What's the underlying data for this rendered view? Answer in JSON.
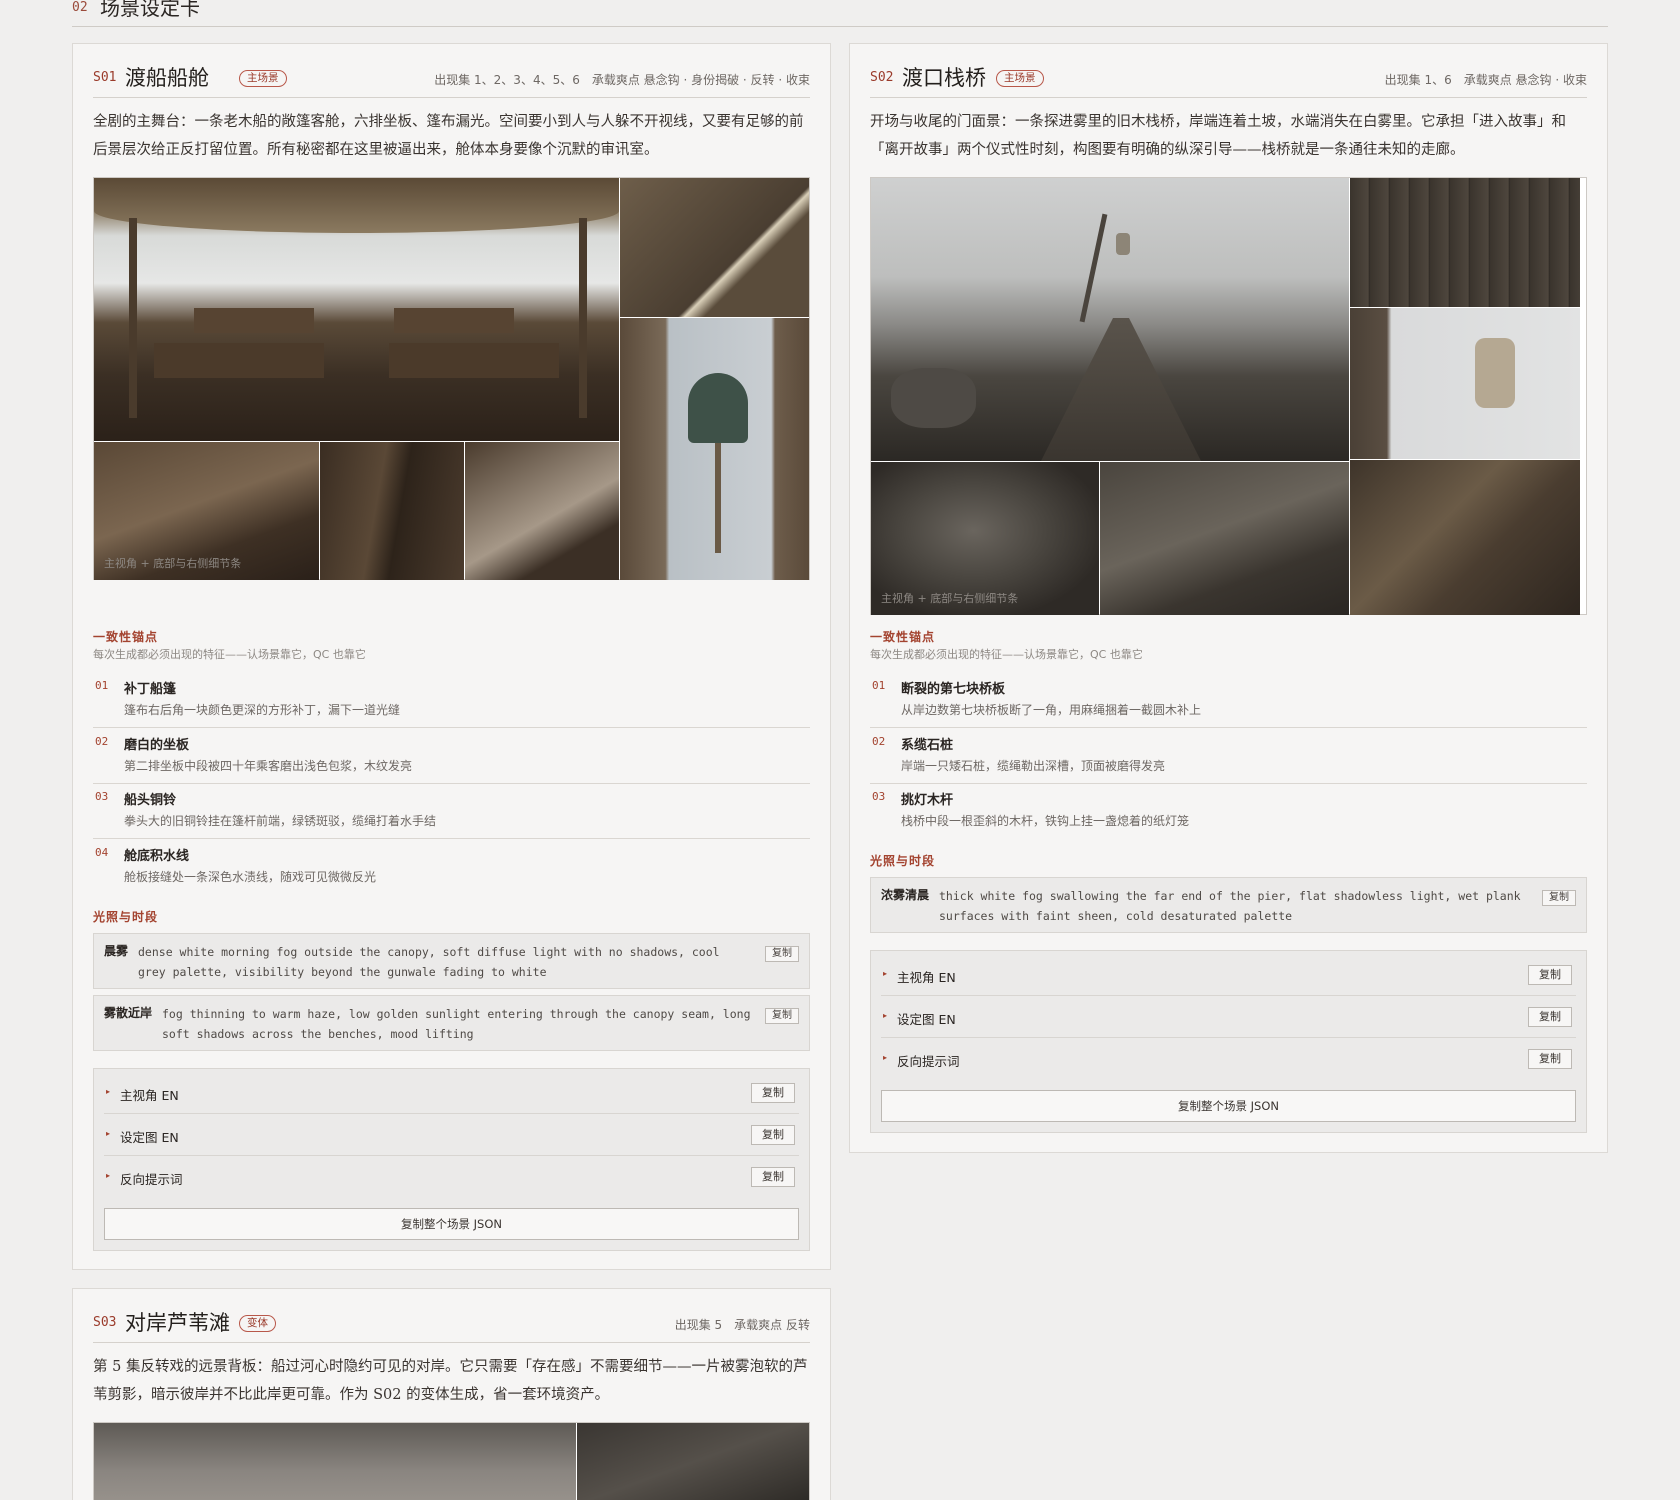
{
  "section": {
    "num": "02",
    "title": "场景设定卡"
  },
  "common": {
    "anchor_title": "一致性锚点",
    "anchor_sub": "每次生成都必须出现的特征——认场景靠它，QC 也靠它",
    "light_title": "光照与时段",
    "copy": "复制",
    "caption": "主视角 + 底部与右侧细节条",
    "prompts": [
      "主视角 EN",
      "设定图 EN",
      "反向提示词"
    ],
    "json_button": "复制整个场景 JSON"
  },
  "s01": {
    "code": "S01",
    "title": "渡船船舱",
    "badge": "主场景",
    "meta": "出现集 1、2、3、4、5、6　承载爽点 悬念钩 · 身份揭破 · 反转 · 收束",
    "desc": "全剧的主舞台：一条老木船的敞篷客舱，六排坐板、篷布漏光。空间要小到人与人躲不开视线，又要有足够的前后景层次给正反打留位置。所有秘密都在这里被逼出来，舱体本身要像个沉默的审讯室。",
    "anchors": [
      {
        "num": "01",
        "name": "补丁船篷",
        "desc": "篷布右后角一块颜色更深的方形补丁，漏下一道光缝"
      },
      {
        "num": "02",
        "name": "磨白的坐板",
        "desc": "第二排坐板中段被四十年乘客磨出浅色包浆，木纹发亮"
      },
      {
        "num": "03",
        "name": "船头铜铃",
        "desc": "拳头大的旧铜铃挂在篷杆前端，绿锈斑驳，缆绳打着水手结"
      },
      {
        "num": "04",
        "name": "舱底积水线",
        "desc": "舱板接缝处一条深色水渍线，随戏可见微微反光"
      }
    ],
    "lights": [
      {
        "label": "晨雾",
        "text": "dense white morning fog outside the canopy, soft diffuse light with no shadows, cool grey palette, visibility beyond the gunwale fading to white"
      },
      {
        "label": "雾散近岸",
        "text": "fog thinning to warm haze, low golden sunlight entering through the canopy seam, long soft shadows across the benches, mood lifting"
      }
    ]
  },
  "s02": {
    "code": "S02",
    "title": "渡口栈桥",
    "badge": "主场景",
    "meta": "出现集 1、6　承载爽点 悬念钩 · 收束",
    "desc": "开场与收尾的门面景：一条探进雾里的旧木栈桥，岸端连着土坡，水端消失在白雾里。它承担「进入故事」和「离开故事」两个仪式性时刻，构图要有明确的纵深引导——栈桥就是一条通往未知的走廊。",
    "anchors": [
      {
        "num": "01",
        "name": "断裂的第七块桥板",
        "desc": "从岸边数第七块桥板断了一角，用麻绳捆着一截圆木补上"
      },
      {
        "num": "02",
        "name": "系缆石桩",
        "desc": "岸端一只矮石桩，缆绳勒出深槽，顶面被磨得发亮"
      },
      {
        "num": "03",
        "name": "挑灯木杆",
        "desc": "栈桥中段一根歪斜的木杆，铁钩上挂一盏熄着的纸灯笼"
      }
    ],
    "lights": [
      {
        "label": "浓雾清晨",
        "text": "thick white fog swallowing the far end of the pier, flat shadowless light, wet plank surfaces with faint sheen, cold desaturated palette"
      }
    ]
  },
  "s03": {
    "code": "S03",
    "title": "对岸芦苇滩",
    "badge": "变体",
    "meta": "出现集 5　承载爽点 反转",
    "desc": "第 5 集反转戏的远景背板：船过河心时隐约可见的对岸。它只需要「存在感」不需要细节——一片被雾泡软的芦苇剪影，暗示彼岸并不比此岸更可靠。作为 S02 的变体生成，省一套环境资产。"
  }
}
